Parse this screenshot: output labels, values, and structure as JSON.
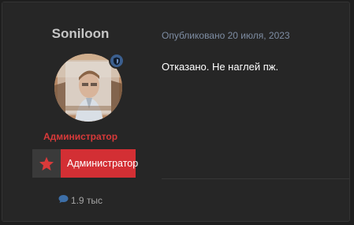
{
  "author": {
    "username": "Soniloon",
    "role_title": "Администратор",
    "role_badge_label": "Администратор",
    "stats": {
      "count_label": "1.9 тыс",
      "icon": "comment-icon"
    },
    "status_icon": "shield-icon",
    "badge_icon": "star-icon"
  },
  "post": {
    "meta": "Опубликовано 20 июля, 2023",
    "text": "Отказано. Не наглей пж."
  },
  "colors": {
    "role": "#d93a3a",
    "badge_bg": "#d32f34",
    "meta": "#7e8da3",
    "background": "#262626"
  }
}
